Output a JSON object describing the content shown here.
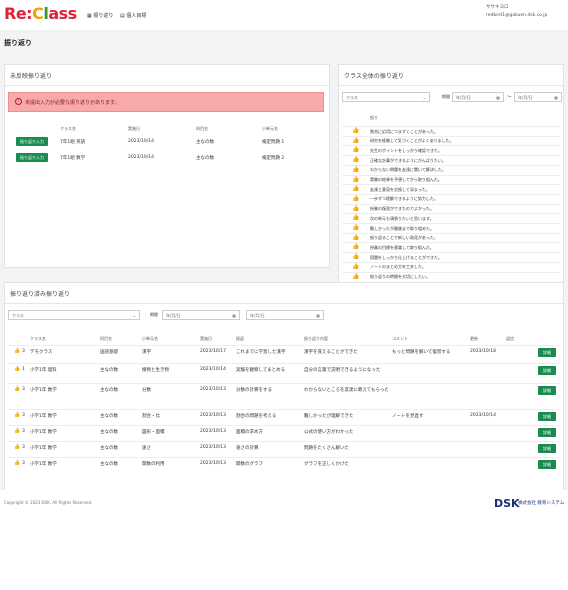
{
  "logo": {
    "p1": "Re:",
    "p2": "C",
    "p3": "l",
    "p4": "ass"
  },
  "nav": {
    "item1": "振り返り",
    "item2": "個人目標"
  },
  "user": {
    "line1": "ササキヨロ",
    "line2": "redbird1@gakuen.dsk.co.jp"
  },
  "page_title": "振り返り",
  "unentered": {
    "title": "未反映振り返り",
    "alert": "未提出入力が必要な振り返りがあります。",
    "headers": [
      "クラス名",
      "実施日",
      "科目名",
      "小単元名"
    ],
    "rows": [
      {
        "btn": "振り返り入力",
        "cls": "7年1組 英語",
        "date": "2023/10/14",
        "subject": "主なの数",
        "unit": "検定問題 1"
      },
      {
        "btn": "振り返り入力",
        "cls": "7年1組 数学",
        "date": "2023/10/14",
        "subject": "主なの数",
        "unit": "検定問題 2"
      }
    ]
  },
  "classview": {
    "title": "クラス全体の振り返り",
    "class_label": "クラス",
    "period_label": "期間",
    "date_ph": "年/月/日",
    "tilde": "〜",
    "col": "振り",
    "rows": [
      {
        "i": "👍",
        "t": "割合に応用につまずくことがあった。"
      },
      {
        "i": "👍",
        "t": "研究を経験して気づくことがよくありました。"
      },
      {
        "i": "👍",
        "t": "先生のポイントをしっかり確認できた。"
      },
      {
        "i": "👍",
        "t": "正確な計算ができるようにがんばりたい。"
      },
      {
        "i": "👍",
        "t": "わからない問題を友達に聞いて解決した。"
      },
      {
        "i": "👍",
        "t": "実験の結果を予想してから取り組んだ。"
      },
      {
        "i": "👍",
        "t": "友達と意見を交換して深まった。"
      },
      {
        "i": "👍",
        "t": "一歩ずつ理解できるように努力した。"
      },
      {
        "i": "👍",
        "t": "授業の復習ができたのでよかった。"
      },
      {
        "i": "👍",
        "t": "次の単元も頑張りたいと思います。"
      },
      {
        "i": "👍",
        "t": "難しかったが最後まで取り組めた。"
      },
      {
        "i": "👍",
        "t": "振り返ることで新しい発見があった。"
      },
      {
        "i": "👍",
        "t": "授業の目標を意識して取り組んだ。"
      },
      {
        "i": "👍",
        "t": "宿題をしっかり仕上げることができた。"
      },
      {
        "i": "👍",
        "t": "ノートのまとめ方を工夫した。"
      },
      {
        "i": "👍",
        "t": "振り返りの時間を大切にしたい。"
      }
    ]
  },
  "reviewed": {
    "title": "振り返り済み振り返り",
    "class_label": "クラス",
    "period_label": "期間",
    "date_ph": "年/月/日",
    "headers": [
      "クラス名",
      "科目名",
      "小単元名",
      "実施日",
      "振返",
      "振り返り内容",
      "コメント",
      "更新",
      "返信"
    ],
    "btn": "詳細",
    "rows": [
      {
        "n": "3",
        "cls": "デモクラス",
        "sub": "国語基礎",
        "unit": "漢字",
        "date": "2023/10/17",
        "f": "これまでに学習した漢字",
        "c": "漢字を覚えることができた",
        "cm": "もっと問題を解いて復習する",
        "up": "2023/10/18"
      },
      {
        "n": "1",
        "cls": "小学1年 理科",
        "sub": "主なの数",
        "unit": "植物と生き物",
        "date": "2023/10/14",
        "f": "実験を観察してまとめる",
        "c": "自分の言葉で説明できるようになった",
        "cm": "",
        "up": ""
      },
      {
        "n": "3",
        "cls": "小学1年 数学",
        "sub": "主なの数",
        "unit": "分数",
        "date": "2023/10/13",
        "f": "分数の計算をする",
        "c": "わからないところを友達に教えてもらった",
        "cm": "",
        "up": ""
      },
      {
        "n": "3",
        "cls": "小学1年 数学",
        "sub": "主なの数",
        "unit": "割合・比",
        "date": "2023/10/13",
        "f": "割合の問題を考える",
        "c": "難しかったが理解できた",
        "cm": "ノートを見直す",
        "up": "2023/10/14"
      },
      {
        "n": "3",
        "cls": "小学1年 数学",
        "sub": "主なの数",
        "unit": "図形・面積",
        "date": "2023/10/13",
        "f": "面積の求め方",
        "c": "公式の使い方がわかった",
        "cm": "",
        "up": ""
      },
      {
        "n": "3",
        "cls": "小学1年 数学",
        "sub": "主なの数",
        "unit": "速さ",
        "date": "2023/10/13",
        "f": "速さの計算",
        "c": "問題をたくさん解いた",
        "cm": "",
        "up": ""
      },
      {
        "n": "3",
        "cls": "小学1年 数学",
        "sub": "主なの数",
        "unit": "関数の利用",
        "date": "2023/10/13",
        "f": "関数のグラフ",
        "c": "グラフを正しくかけた",
        "cm": "",
        "up": ""
      }
    ]
  },
  "footer": {
    "copy": "Copyright © 2023 DSK. All Rights Reserved.",
    "brand": "DSK",
    "company": "株式会社 教育システム"
  },
  "colors": {
    "accent": "#1c8b50",
    "alert": "#f8a9ac",
    "brand": "#1a2f7a"
  }
}
